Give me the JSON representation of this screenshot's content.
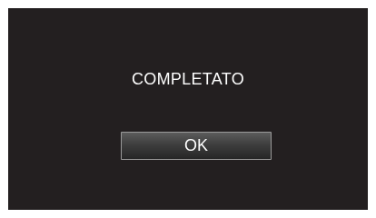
{
  "dialog": {
    "message": "COMPLETATO",
    "ok_label": "OK"
  },
  "colors": {
    "screen_background": "#231f20",
    "text": "#ffffff",
    "button_border": "#9a9a9a"
  }
}
